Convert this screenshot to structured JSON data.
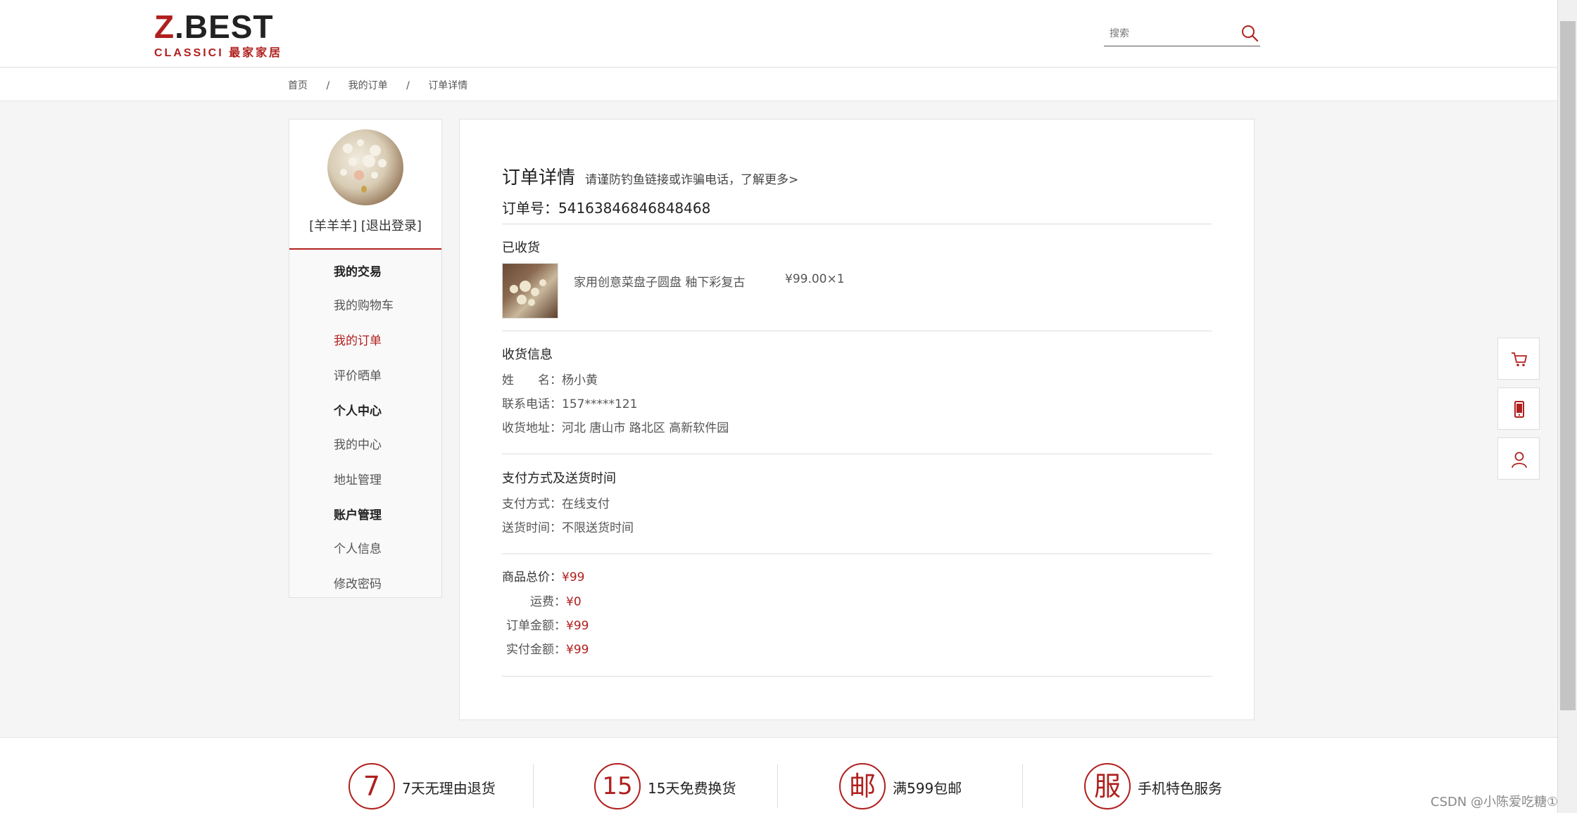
{
  "header": {
    "logo_main_prefix": "Z",
    "logo_main_rest": ".BEST",
    "logo_sub": "CLASSICI 最家家居",
    "search_placeholder": "搜索"
  },
  "breadcrumb": [
    "首页",
    "我的订单",
    "订单详情"
  ],
  "breadcrumb_sep": "/",
  "sidebar": {
    "user_name": "[羊羊羊]",
    "logout": "[退出登录]",
    "sections": [
      {
        "title": "我的交易",
        "items": [
          "我的购物车",
          "我的订单",
          "评价晒单"
        ]
      },
      {
        "title": "个人中心",
        "items": [
          "我的中心",
          "地址管理"
        ]
      },
      {
        "title": "账户管理",
        "items": [
          "个人信息",
          "修改密码"
        ]
      }
    ],
    "active_item": "我的订单"
  },
  "order": {
    "title": "订单详情",
    "notice": "请谨防钓鱼链接或诈骗电话，了解更多>",
    "number_label": "订单号：",
    "number": "54163846846848468",
    "status": "已收货",
    "product": {
      "name": "家用创意菜盘子圆盘 釉下彩复古",
      "price_qty": "¥99.00×1"
    },
    "receiver": {
      "title": "收货信息",
      "name_label": "姓　　名：",
      "name": "杨小黄",
      "phone_label": "联系电话：",
      "phone": "157*****121",
      "address_label": "收货地址：",
      "address": "河北 唐山市 路北区 高新软件园"
    },
    "payment": {
      "title": "支付方式及送货时间",
      "method_label": "支付方式：",
      "method": "在线支付",
      "delivery_label": "送货时间：",
      "delivery": "不限送货时间"
    },
    "totals": {
      "goods_label": "商品总价：",
      "goods": "¥99",
      "freight_label": "运费：",
      "freight": "¥0",
      "order_label": "订单金额：",
      "order": "¥99",
      "paid_label": "实付金额：",
      "paid": "¥99"
    }
  },
  "float_toolbar": [
    "cart-icon",
    "phone-icon",
    "user-icon"
  ],
  "services": [
    {
      "icon": "7",
      "text": "7天无理由退货"
    },
    {
      "icon": "15",
      "text": "15天免费换货"
    },
    {
      "icon": "邮",
      "text": "满599包邮"
    },
    {
      "icon": "服",
      "text": "手机特色服务"
    }
  ],
  "watermark": "CSDN @小陈爱吃糖①",
  "colors": {
    "accent": "#b0201e"
  }
}
